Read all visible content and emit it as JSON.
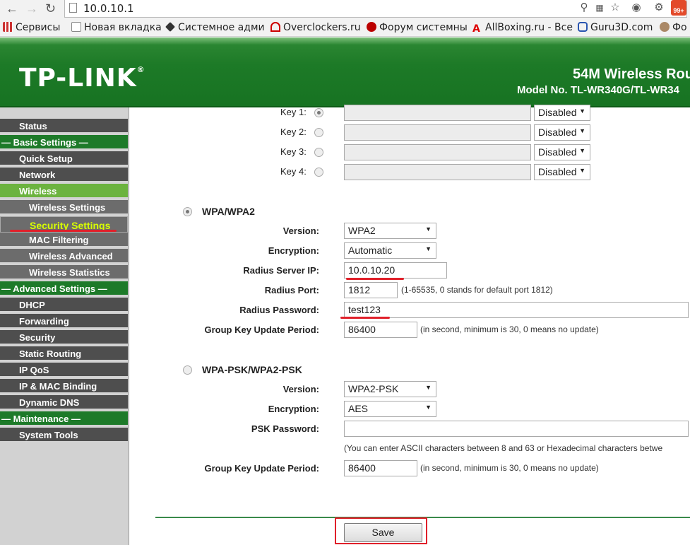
{
  "browser": {
    "url": "10.0.10.1",
    "bookmarks": [
      {
        "label": "Сервисы",
        "icon": "apps-grid-icon"
      },
      {
        "label": "Новая вкладка",
        "icon": "page-icon"
      },
      {
        "label": "Системное адми",
        "icon": "diamond-icon"
      },
      {
        "label": "Overclockers.ru",
        "icon": "overclockers-icon"
      },
      {
        "label": "Форум системны",
        "icon": "forum-icon"
      },
      {
        "label": "AllBoxing.ru - Все",
        "icon": "allboxing-icon"
      },
      {
        "label": "Guru3D.com",
        "icon": "guru3d-icon"
      },
      {
        "label": "Фо",
        "icon": "forum2-icon"
      }
    ],
    "badge": "99+"
  },
  "header": {
    "logo": "TP-LINK",
    "product": "54M Wireless Rou",
    "model": "Model No. TL-WR340G/TL-WR34"
  },
  "sidebar": {
    "items": [
      {
        "label": "Status"
      },
      {
        "label": "— Basic Settings —"
      },
      {
        "label": "Quick Setup"
      },
      {
        "label": "Network"
      },
      {
        "label": "Wireless"
      },
      {
        "label": "Wireless Settings"
      },
      {
        "label": "Security Settings"
      },
      {
        "label": "MAC Filtering"
      },
      {
        "label": "Wireless Advanced"
      },
      {
        "label": "Wireless Statistics"
      },
      {
        "label": "— Advanced Settings —"
      },
      {
        "label": "DHCP"
      },
      {
        "label": "Forwarding"
      },
      {
        "label": "Security"
      },
      {
        "label": "Static Routing"
      },
      {
        "label": "IP QoS"
      },
      {
        "label": "IP & MAC Binding"
      },
      {
        "label": "Dynamic DNS"
      },
      {
        "label": "— Maintenance —"
      },
      {
        "label": "System Tools"
      }
    ]
  },
  "wep_keys": [
    {
      "label": "Key 1:",
      "type": "Disabled"
    },
    {
      "label": "Key 2:",
      "type": "Disabled"
    },
    {
      "label": "Key 3:",
      "type": "Disabled"
    },
    {
      "label": "Key 4:",
      "type": "Disabled"
    }
  ],
  "wpa": {
    "title": "WPA/WPA2",
    "version_label": "Version:",
    "version": "WPA2",
    "encryption_label": "Encryption:",
    "encryption": "Automatic",
    "radius_ip_label": "Radius Server IP:",
    "radius_ip": "10.0.10.20",
    "radius_port_label": "Radius Port:",
    "radius_port": "1812",
    "radius_port_note": "(1-65535, 0 stands for default port 1812)",
    "radius_password_label": "Radius Password:",
    "radius_password": "test123",
    "group_key_label": "Group Key Update Period:",
    "group_key": "86400",
    "group_key_note": "(in second, minimum is 30, 0 means no update)"
  },
  "psk": {
    "title": "WPA-PSK/WPA2-PSK",
    "version_label": "Version:",
    "version": "WPA2-PSK",
    "encryption_label": "Encryption:",
    "encryption": "AES",
    "password_label": "PSK Password:",
    "password": "",
    "password_note": "(You can enter ASCII characters between 8 and 63 or Hexadecimal characters betwe",
    "group_key_label": "Group Key Update Period:",
    "group_key": "86400",
    "group_key_note": "(in second, minimum is 30, 0 means no update)"
  },
  "actions": {
    "save": "Save"
  },
  "colors": {
    "brand_green": "#1d7a29",
    "active_green": "#6cb33f",
    "highlight_red": "#e0202a",
    "selected_text": "#d8ff00"
  }
}
